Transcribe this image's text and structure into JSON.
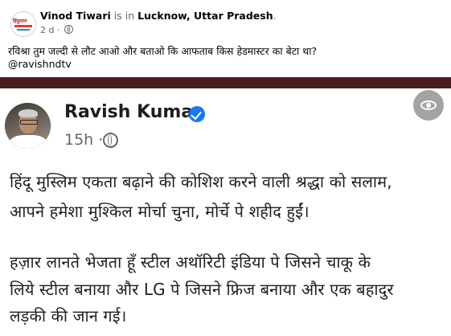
{
  "post": {
    "author": "Vinod Tiwari",
    "is_in": "is in",
    "location": "Lucknow, Uttar Pradesh",
    "location_suffix": ".",
    "time": "2 d ·",
    "avatar_logo_text": "हिंदुस्तान",
    "text": "रविश्रा तुम  जल्दी से लौट आओ और बताओ कि आफताब किस हेडमास्टर का बेटा था?",
    "mention": "@ravishndtv"
  },
  "embedded_post": {
    "author": "Ravish Kumar",
    "time": "15h ·",
    "line1": "हिंदू मुस्लिम एकता बढ़ाने की कोशिश करने वाली श्रद्धा को सलाम,",
    "line2": "आपने हमेशा मुश्किल मोर्चा चुना, मोर्चे पे शहीद हुईं।",
    "line3": "हज़ार लानते भेजता हूँ स्टील अथॉरिटी इंडिया पे जिसने चाकू के",
    "line4": "लिये स्टील बनाया और LG पे जिसने फ्रिज बनाया और एक बहादुर",
    "line5": "लड़की की जान गई।"
  },
  "icons": {
    "verified": "verified-badge-icon",
    "globe": "globe-icon",
    "eye": "eye-icon"
  },
  "colors": {
    "divider": "#4a1d1f",
    "verified": "#1877f2",
    "text": "#1c1e21",
    "meta": "#65676b"
  }
}
